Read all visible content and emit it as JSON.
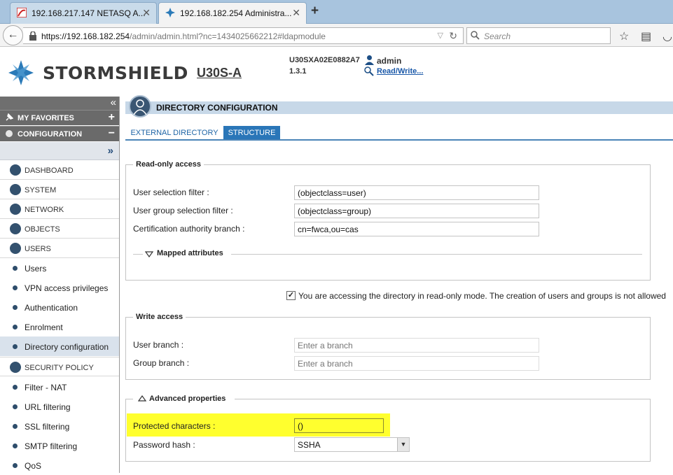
{
  "browser": {
    "tabs": [
      {
        "title": "192.168.217.147 NETASQ A..."
      },
      {
        "title": "192.168.182.254 Administra..."
      }
    ],
    "url_host": "https://192.168.182.254",
    "url_path": "/admin/admin.html?nc=1434025662212#ldapmodule",
    "search_placeholder": "Search"
  },
  "header": {
    "brand": "STORMSHIELD",
    "model": "U30S-A",
    "serial": "U30SXA02E0882A7",
    "version": "1.3.1",
    "user": "admin",
    "access_link": "Read/Write..."
  },
  "sidebar": {
    "favorites": "MY FAVORITES",
    "configuration": "CONFIGURATION",
    "modules": [
      {
        "label": "DASHBOARD"
      },
      {
        "label": "SYSTEM"
      },
      {
        "label": "NETWORK"
      },
      {
        "label": "OBJECTS"
      },
      {
        "label": "USERS"
      }
    ],
    "users_items": [
      {
        "label": "Users"
      },
      {
        "label": "VPN access privileges"
      },
      {
        "label": "Authentication"
      },
      {
        "label": "Enrolment"
      },
      {
        "label": "Directory configuration"
      }
    ],
    "security_policy": "SECURITY POLICY",
    "policy_items": [
      {
        "label": "Filter - NAT"
      },
      {
        "label": "URL filtering"
      },
      {
        "label": "SSL filtering"
      },
      {
        "label": "SMTP filtering"
      },
      {
        "label": "QoS"
      }
    ]
  },
  "page": {
    "title": "DIRECTORY CONFIGURATION",
    "tabs": [
      {
        "label": "EXTERNAL DIRECTORY"
      },
      {
        "label": "STRUCTURE"
      }
    ],
    "readonly_access": {
      "legend": "Read-only access",
      "user_filter_label": "User selection filter :",
      "user_filter_value": "(objectclass=user)",
      "group_filter_label": "User group selection filter :",
      "group_filter_value": "(objectclass=group)",
      "ca_branch_label": "Certification authority branch :",
      "ca_branch_value": "cn=fwca,ou=cas",
      "mapped_attributes": "Mapped attributes"
    },
    "readonly_notice": "You are accessing the directory in read-only mode. The creation of users and groups is not allowed",
    "readonly_checked": true,
    "write_access": {
      "legend": "Write access",
      "user_branch_label": "User branch :",
      "user_branch_placeholder": "Enter a branch",
      "group_branch_label": "Group branch :",
      "group_branch_placeholder": "Enter a branch"
    },
    "advanced": {
      "legend": "Advanced properties",
      "protected_label": "Protected characters :",
      "protected_value": "()",
      "hash_label": "Password hash :",
      "hash_value": "SSHA"
    }
  }
}
